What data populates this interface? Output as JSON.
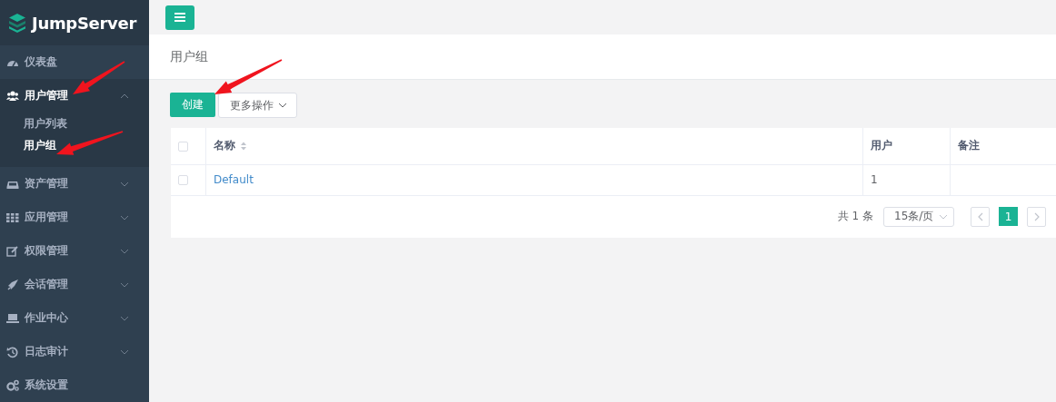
{
  "sidebar": {
    "logo": "JumpServer",
    "items": [
      {
        "label": "仪表盘",
        "kind": "link"
      },
      {
        "label": "用户管理",
        "kind": "group",
        "expanded": true,
        "children": [
          {
            "label": "用户列表",
            "selected": false
          },
          {
            "label": "用户组",
            "selected": true
          }
        ]
      },
      {
        "label": "资产管理",
        "kind": "group",
        "expanded": false
      },
      {
        "label": "应用管理",
        "kind": "group",
        "expanded": false
      },
      {
        "label": "权限管理",
        "kind": "group",
        "expanded": false
      },
      {
        "label": "会话管理",
        "kind": "group",
        "expanded": false
      },
      {
        "label": "作业中心",
        "kind": "group",
        "expanded": false
      },
      {
        "label": "日志审计",
        "kind": "group",
        "expanded": false
      },
      {
        "label": "系统设置",
        "kind": "link"
      }
    ]
  },
  "page_title": "用户组",
  "toolbar": {
    "create_button": "创建",
    "more_button": "更多操作"
  },
  "table": {
    "columns": [
      {
        "label": "名称",
        "sortable": true
      },
      {
        "label": "用户",
        "sortable": false
      },
      {
        "label": "备注",
        "sortable": false
      }
    ],
    "select_all_checked": false,
    "rows": [
      {
        "checked": false,
        "cells": [
          "Default",
          "1"
        ]
      }
    ]
  },
  "pagination": {
    "total": "共 1 条",
    "page_size": "15条/页",
    "pages": [
      {
        "label": "1",
        "selected": true
      }
    ]
  }
}
